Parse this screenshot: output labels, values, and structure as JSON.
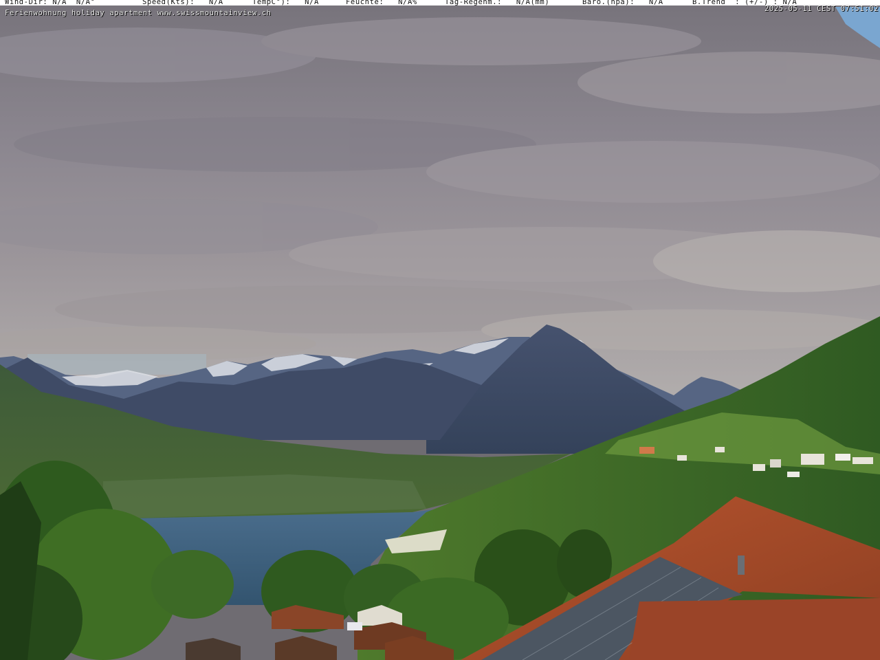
{
  "overlay": {
    "wind_dir": "Wind-Dir: N/A  N/A°",
    "speed": "Speed(Kts):   N/A",
    "temp": "TempC°):   N/A",
    "feuchte": "Feuchte:   N/A%",
    "regen": "Tag-Regenm.:   N/A(mm)",
    "baro": "Baro.(hpa):   N/A",
    "trend": "B.Trend  : (+/-) : N/A",
    "timestamp": "2025-05-11 CEST 07:51:02",
    "caption": "Ferienwohnung holiday apartment www.swissmountainview.ch"
  },
  "colors": {
    "sky_cloud": "#8a8690",
    "sky_blue": "#7aa6d0",
    "mountain": "#3c4a66",
    "lake": "#3d5f82",
    "forest": "#2f5a22",
    "roof": "#a24a2a"
  }
}
